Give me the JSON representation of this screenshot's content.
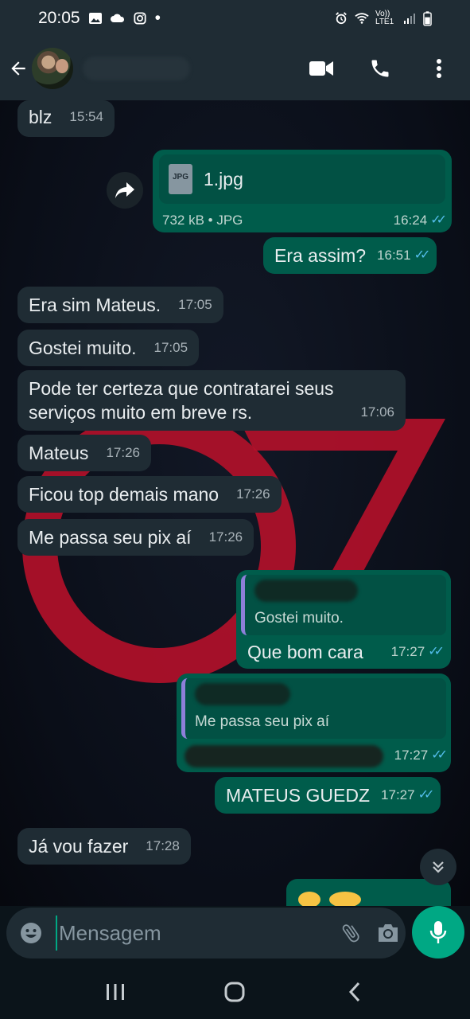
{
  "status_bar": {
    "time": "20:05",
    "dot": "•",
    "network": "Vo)) LTE1"
  },
  "header": {
    "contact_name": "",
    "icons": [
      "back-arrow-icon",
      "video-call-icon",
      "phone-icon",
      "more-vert-icon"
    ]
  },
  "messages": [
    {
      "dir": "in",
      "text": "blz",
      "time": "15:54"
    },
    {
      "dir": "out",
      "type": "file",
      "file_name": "1.jpg",
      "file_icon_label": "JPG",
      "file_meta": "732 kB • JPG",
      "time": "16:24"
    },
    {
      "dir": "out",
      "text": "Era assim?",
      "time": "16:51"
    },
    {
      "dir": "in",
      "text": "Era sim Mateus.",
      "time": "17:05"
    },
    {
      "dir": "in",
      "text": "Gostei muito.",
      "time": "17:05"
    },
    {
      "dir": "in",
      "text_line1": "Pode ter certeza que contratarei seus",
      "text_line2": "serviços muito em breve rs.",
      "time": "17:06"
    },
    {
      "dir": "in",
      "text": "Mateus",
      "time": "17:26"
    },
    {
      "dir": "in",
      "text": "Ficou top demais mano",
      "time": "17:26"
    },
    {
      "dir": "in",
      "text": "Me passa seu pix aí",
      "time": "17:26"
    },
    {
      "dir": "out",
      "quote": "Gostei muito.",
      "text": "Que bom cara",
      "time": "17:27"
    },
    {
      "dir": "out",
      "quote": "Me passa seu pix aí",
      "text": "",
      "time": "17:27"
    },
    {
      "dir": "out",
      "text": "MATEUS GUEDZ",
      "time": "17:27"
    },
    {
      "dir": "in",
      "text": "Já vou fazer",
      "time": "17:28"
    }
  ],
  "ticks": "✓✓",
  "input": {
    "placeholder": "Mensagem"
  },
  "colors": {
    "header": "#1f2c34",
    "incoming": "#1f2c34",
    "outgoing": "#005c4b",
    "accent": "#00a884",
    "read_ticks": "#53bdeb",
    "wallpaper_logo": "#c8102e"
  }
}
